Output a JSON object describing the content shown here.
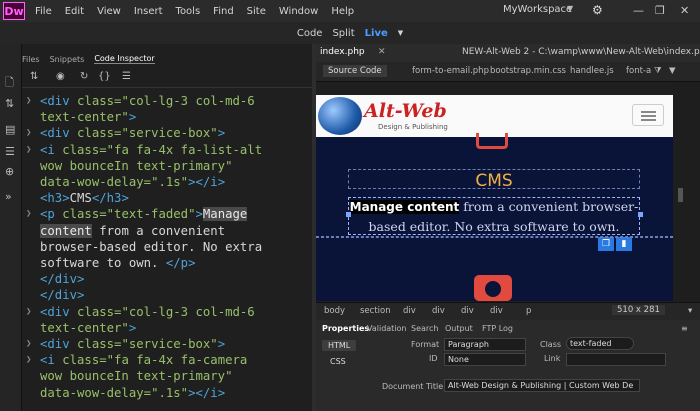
{
  "app": {
    "logo": "Dw",
    "menu": [
      "File",
      "Edit",
      "View",
      "Insert",
      "Tools",
      "Find",
      "Site",
      "Window",
      "Help"
    ],
    "workspace": "MyWorkspace"
  },
  "viewbar": {
    "code": "Code",
    "split": "Split",
    "live": "Live"
  },
  "left_panel": {
    "tabs": [
      "Files",
      "Snippets",
      "Code Inspector"
    ],
    "code_lines": [
      [
        {
          "c": "tag",
          "t": "<div "
        },
        {
          "c": "attr",
          "t": "class="
        },
        {
          "c": "attr",
          "t": "\"col-lg-3 col-md-6"
        }
      ],
      [
        {
          "c": "attr",
          "t": "text-center\""
        },
        {
          "c": "tag",
          "t": ">"
        }
      ],
      [
        {
          "c": "tag",
          "t": "<div "
        },
        {
          "c": "attr",
          "t": "class="
        },
        {
          "c": "attr",
          "t": "\"service-box\""
        },
        {
          "c": "tag",
          "t": ">"
        }
      ],
      [
        {
          "c": "tag",
          "t": "<i "
        },
        {
          "c": "attr",
          "t": "class="
        },
        {
          "c": "attr",
          "t": "\"fa fa-4x fa-list-alt"
        }
      ],
      [
        {
          "c": "attr",
          "t": "wow bounceIn text-primary\""
        }
      ],
      [
        {
          "c": "attr",
          "t": "data-wow-delay="
        },
        {
          "c": "attr",
          "t": "\".1s\""
        },
        {
          "c": "tag",
          "t": "></i>"
        }
      ],
      [
        {
          "c": "tag",
          "t": "<h3>"
        },
        {
          "c": "txt",
          "t": "CMS"
        },
        {
          "c": "tag",
          "t": "</h3>"
        }
      ],
      [
        {
          "c": "tag",
          "t": "<p "
        },
        {
          "c": "attr",
          "t": "class="
        },
        {
          "c": "attr",
          "t": "\"text-faded\""
        },
        {
          "c": "tag",
          "t": ">"
        },
        {
          "c": "sel",
          "t": "Manage"
        }
      ],
      [
        {
          "c": "sel",
          "t": "content"
        },
        {
          "c": "txt",
          "t": " from a convenient"
        }
      ],
      [
        {
          "c": "txt",
          "t": "browser-based editor. No extra"
        }
      ],
      [
        {
          "c": "txt",
          "t": "software to own. "
        },
        {
          "c": "tag",
          "t": "</p>"
        }
      ],
      [
        {
          "c": "tag",
          "t": "</div>"
        }
      ],
      [
        {
          "c": "tag",
          "t": "</div>"
        }
      ],
      [
        {
          "c": "tag",
          "t": "<div "
        },
        {
          "c": "attr",
          "t": "class="
        },
        {
          "c": "attr",
          "t": "\"col-lg-3 col-md-6"
        }
      ],
      [
        {
          "c": "attr",
          "t": "text-center\""
        },
        {
          "c": "tag",
          "t": ">"
        }
      ],
      [
        {
          "c": "tag",
          "t": "<div "
        },
        {
          "c": "attr",
          "t": "class="
        },
        {
          "c": "attr",
          "t": "\"service-box\""
        },
        {
          "c": "tag",
          "t": ">"
        }
      ],
      [
        {
          "c": "tag",
          "t": "<i "
        },
        {
          "c": "attr",
          "t": "class="
        },
        {
          "c": "attr",
          "t": "\"fa fa-4x fa-camera"
        }
      ],
      [
        {
          "c": "attr",
          "t": "wow bounceIn text-primary\""
        }
      ],
      [
        {
          "c": "attr",
          "t": "data-wow-delay="
        },
        {
          "c": "attr",
          "t": "\".1s\""
        },
        {
          "c": "tag",
          "t": "></i>"
        }
      ]
    ]
  },
  "document": {
    "tab": "index.php",
    "path": "NEW-Alt-Web 2 - C:\\wamp\\www\\New-Alt-Web\\index.php",
    "source_code": "Source Code",
    "related_files": [
      "form-to-email.php",
      "bootstrap.min.css",
      "handlee.js",
      "font-a"
    ]
  },
  "live": {
    "brand": "Alt-Web",
    "brand_sub": "Design & Publishing",
    "heading": "CMS",
    "para_highlight": "Manage content",
    "para_rest_1": " from a convenient browser-",
    "para_rest_2": "based editor. No extra software to own."
  },
  "tag_selector": {
    "tags": [
      "body",
      "section",
      "div",
      "div",
      "div",
      "div",
      "p"
    ],
    "size": "510 x 281"
  },
  "properties": {
    "tabs": [
      "Properties",
      "Validation",
      "Search",
      "Output",
      "FTP Log"
    ],
    "html_btn": "HTML",
    "css_btn": "CSS",
    "format_label": "Format",
    "format_value": "Paragraph",
    "id_label": "ID",
    "id_value": "None",
    "class_label": "Class",
    "class_value": "text-faded",
    "link_label": "Link",
    "doc_title_label": "Document Title",
    "doc_title_value": "Alt-Web Design & Publishing | Custom Web De"
  }
}
